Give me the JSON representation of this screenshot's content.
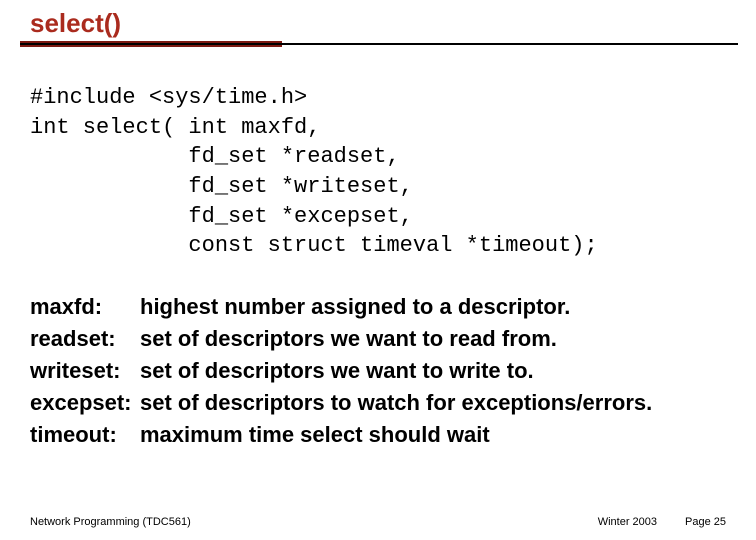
{
  "title": "select()",
  "code": "#include <sys/time.h>\nint select( int maxfd,\n            fd_set *readset,\n            fd_set *writeset,\n            fd_set *excepset,\n            const struct timeval *timeout);",
  "defs": [
    {
      "term": "maxfd:",
      "desc": "highest number assigned to a descriptor."
    },
    {
      "term": "readset:",
      "desc": "set of descriptors we want to read from."
    },
    {
      "term": "writeset:",
      "desc": "set of descriptors we want to write to."
    },
    {
      "term": "excepset:",
      "desc": "set of descriptors to watch for  exceptions/errors."
    },
    {
      "term": "timeout:",
      "desc": "maximum time select should wait"
    }
  ],
  "footer": {
    "left": "Network Programming (TDC561)",
    "center": "Winter 2003",
    "right": "Page 25"
  }
}
